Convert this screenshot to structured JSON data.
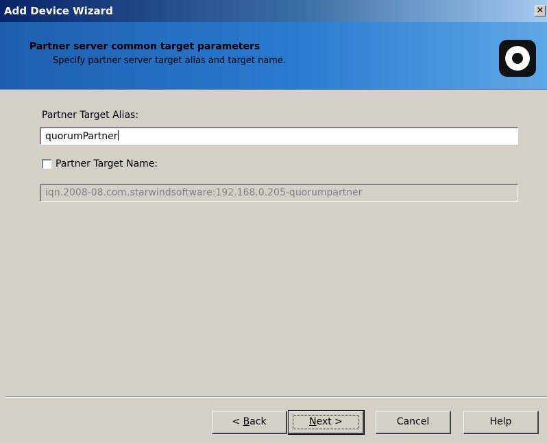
{
  "window": {
    "title": "Add Device Wizard",
    "close_glyph": "✕"
  },
  "header": {
    "title": "Partner server common target parameters",
    "subtitle": "Specify partner server target alias and target name.",
    "logo_icon": "starwind-logo-icon"
  },
  "form": {
    "alias_label": "Partner Target Alias:",
    "alias_value": "quorumPartner",
    "target_name_label": "Partner Target Name:",
    "target_name_checked": false,
    "target_name_value": "iqn.2008-08.com.starwindsoftware:192.168.0.205-quorumpartner"
  },
  "buttons": {
    "back": {
      "prefix": "< ",
      "mnemonic": "B",
      "rest": "ack"
    },
    "next": {
      "mnemonic": "N",
      "rest": "ext >"
    },
    "cancel": "Cancel",
    "help": "Help"
  },
  "colors": {
    "titlebar_start": "#0a246a",
    "banner": "#2a7bd1",
    "dialog_bg": "#d4d0c8"
  }
}
